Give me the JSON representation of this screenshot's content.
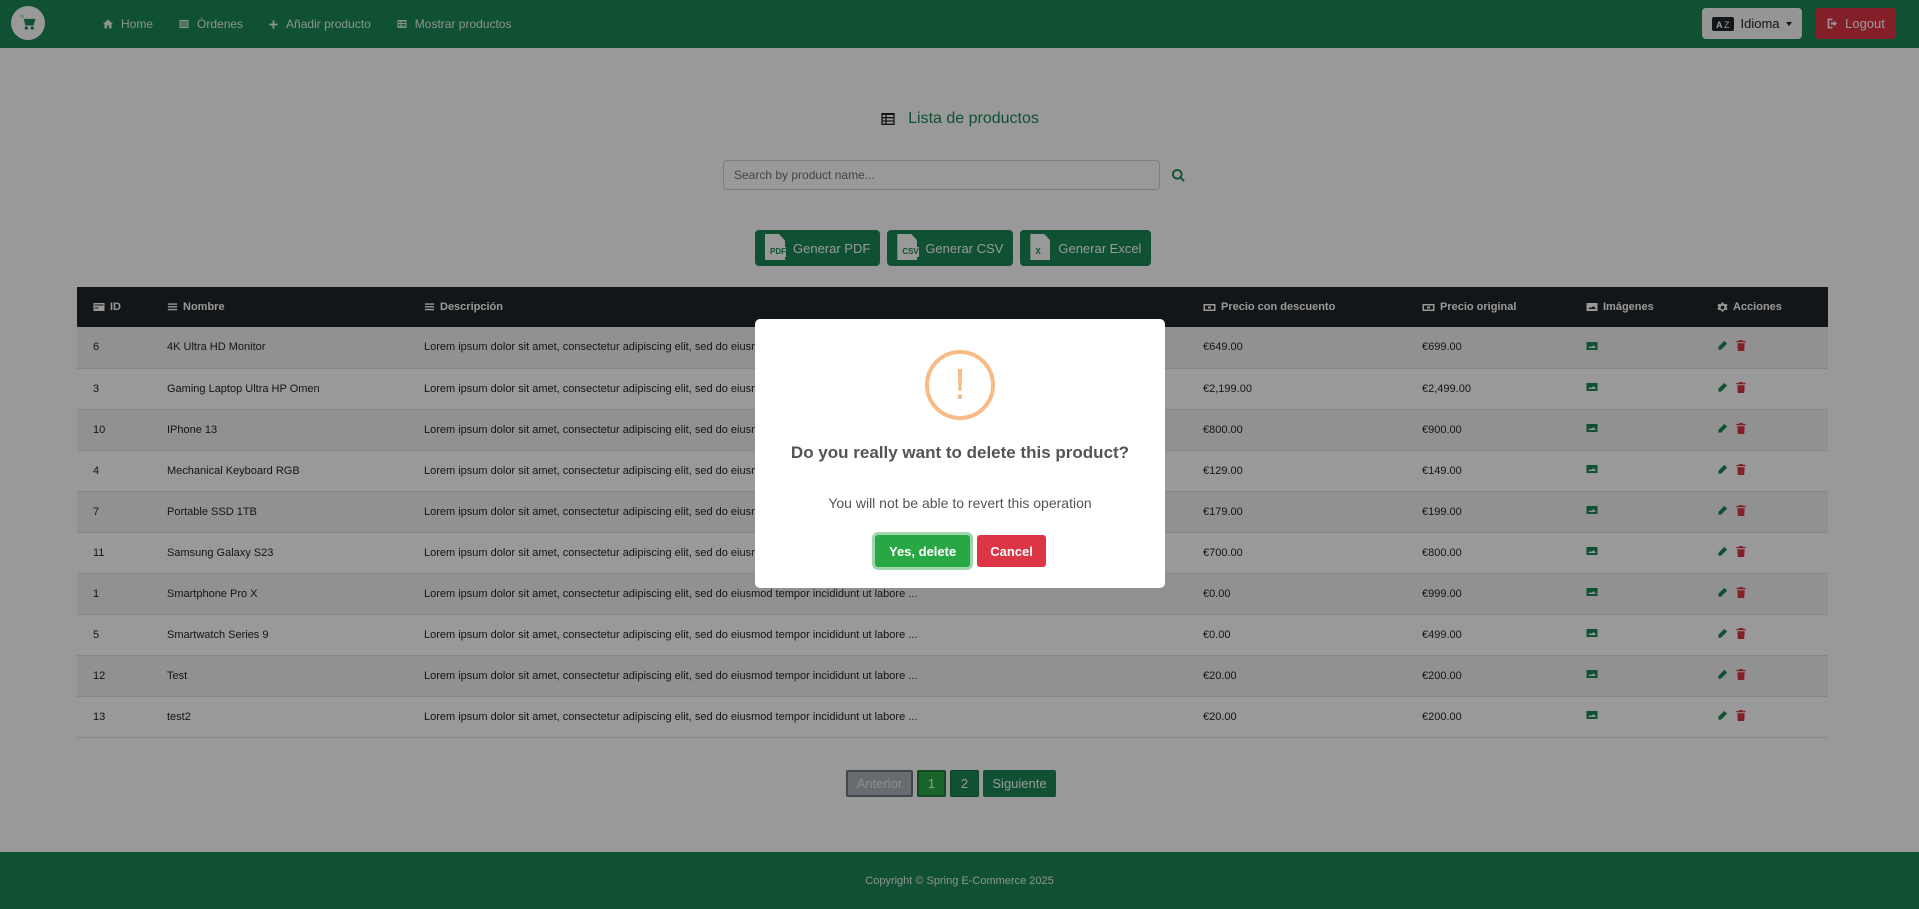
{
  "nav": {
    "items": [
      {
        "label": "Home",
        "icon": "home-icon"
      },
      {
        "label": "Órdenes",
        "icon": "list-icon"
      },
      {
        "label": "Añadir producto",
        "icon": "plus-icon"
      },
      {
        "label": "Mostrar productos",
        "icon": "table-icon"
      }
    ],
    "language_label": "Idioma",
    "logout_label": "Logout"
  },
  "main": {
    "title": "Lista de productos",
    "search_placeholder": "Search by product name...",
    "exports": [
      {
        "label": "Generar PDF",
        "tag": "PDF"
      },
      {
        "label": "Generar CSV",
        "tag": "CSV"
      },
      {
        "label": "Generar Excel",
        "tag": "X"
      }
    ]
  },
  "table": {
    "headers": [
      "ID",
      "Nombre",
      "Descripción",
      "Precio con descuento",
      "Precio original",
      "Imágenes",
      "Acciones"
    ],
    "rows": [
      {
        "id": "6",
        "name": "4K Ultra HD Monitor",
        "desc": "Lorem ipsum dolor sit amet, consectetur adipiscing elit, sed do eiusmod tempor incididunt ut labore ...",
        "discount": "€649.00",
        "original": "€699.00"
      },
      {
        "id": "3",
        "name": "Gaming Laptop Ultra HP Omen",
        "desc": "Lorem ipsum dolor sit amet, consectetur adipiscing elit, sed do eiusmod tempor incididunt ut labore ...",
        "discount": "€2,199.00",
        "original": "€2,499.00"
      },
      {
        "id": "10",
        "name": "IPhone 13",
        "desc": "Lorem ipsum dolor sit amet, consectetur adipiscing elit, sed do eiusmod tempor incididunt ut labore ...",
        "discount": "€800.00",
        "original": "€900.00"
      },
      {
        "id": "4",
        "name": "Mechanical Keyboard RGB",
        "desc": "Lorem ipsum dolor sit amet, consectetur adipiscing elit, sed do eiusmod tempor incididunt ut labore ...",
        "discount": "€129.00",
        "original": "€149.00"
      },
      {
        "id": "7",
        "name": "Portable SSD 1TB",
        "desc": "Lorem ipsum dolor sit amet, consectetur adipiscing elit, sed do eiusmod tempor incididunt ut labore ...",
        "discount": "€179.00",
        "original": "€199.00"
      },
      {
        "id": "11",
        "name": "Samsung Galaxy S23",
        "desc": "Lorem ipsum dolor sit amet, consectetur adipiscing elit, sed do eiusmod tempor incididunt ut labore ...",
        "discount": "€700.00",
        "original": "€800.00"
      },
      {
        "id": "1",
        "name": "Smartphone Pro X",
        "desc": "Lorem ipsum dolor sit amet, consectetur adipiscing elit, sed do eiusmod tempor incididunt ut labore ...",
        "discount": "€0.00",
        "original": "€999.00"
      },
      {
        "id": "5",
        "name": "Smartwatch Series 9",
        "desc": "Lorem ipsum dolor sit amet, consectetur adipiscing elit, sed do eiusmod tempor incididunt ut labore ...",
        "discount": "€0.00",
        "original": "€499.00"
      },
      {
        "id": "12",
        "name": "Test",
        "desc": "Lorem ipsum dolor sit amet, consectetur adipiscing elit, sed do eiusmod tempor incididunt ut labore ...",
        "discount": "€20.00",
        "original": "€200.00"
      },
      {
        "id": "13",
        "name": "test2",
        "desc": "Lorem ipsum dolor sit amet, consectetur adipiscing elit, sed do eiusmod tempor incididunt ut labore ...",
        "discount": "€20.00",
        "original": "€200.00"
      }
    ]
  },
  "pagination": {
    "prev": "Anterior",
    "pages": [
      "1",
      "2"
    ],
    "current": "1",
    "next": "Siguiente"
  },
  "footer": {
    "text": "Copyright © Spring E-Commerce 2025"
  },
  "modal": {
    "icon_glyph": "!",
    "title": "Do you really want to delete this product?",
    "text": "You will not be able to revert this operation",
    "confirm": "Yes, delete",
    "cancel": "Cancel"
  },
  "colors": {
    "primary": "#198754",
    "danger": "#dc3545",
    "confirm": "#28a745",
    "warning": "#f8bb86",
    "header_dark": "#212529"
  }
}
